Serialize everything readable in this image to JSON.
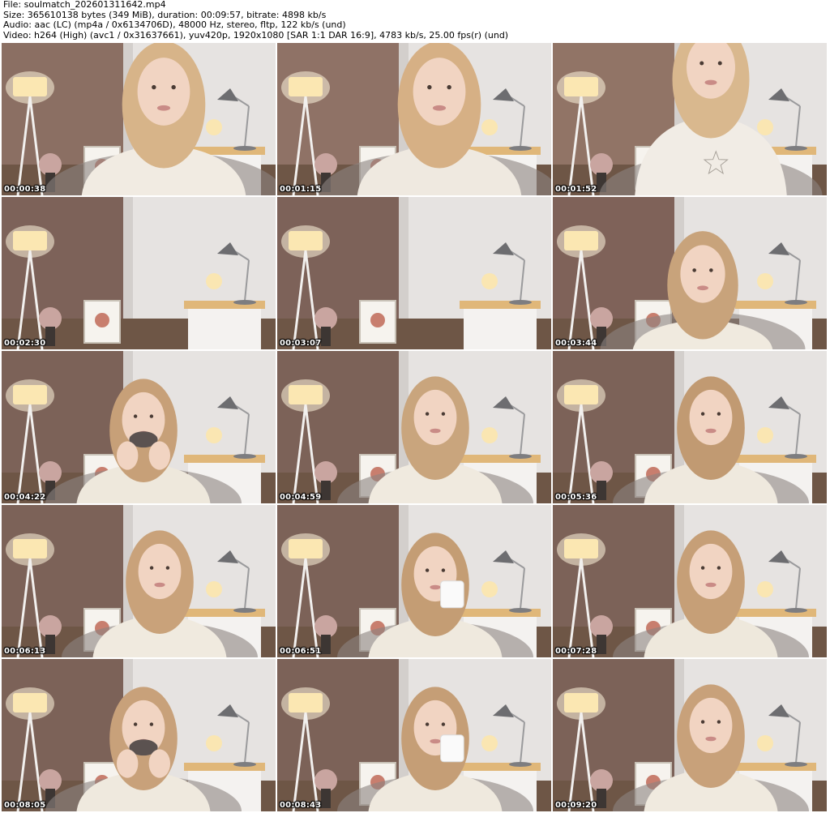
{
  "header": {
    "file_line": "File: soulmatch_202601311642.mp4",
    "size_line": "Size: 365610138 bytes (349 MiB), duration: 00:09:57, bitrate: 4898 kb/s",
    "audio_line": "Audio: aac (LC) (mp4a / 0x6134706D), 48000 Hz, stereo, fltp, 122 kb/s (und)",
    "video_line": "Video: h264 (High) (avc1 / 0x31637661), yuv420p, 1920x1080 [SAR 1:1 DAR 16:9], 4783 kb/s, 25.00 fps(r) (und)"
  },
  "thumbnails": [
    {
      "time": "00:00:38",
      "scene": "person-close",
      "wall": "#8b6f63",
      "shirt": "#f1ebe2",
      "hair": "#d7b489"
    },
    {
      "time": "00:01:15",
      "scene": "person-close",
      "wall": "#8f7266",
      "shirt": "#efe9e0",
      "hair": "#d6b085"
    },
    {
      "time": "00:01:52",
      "scene": "person-standing",
      "wall": "#917466",
      "shirt": "#f1ece5",
      "hair": "#d9b88e"
    },
    {
      "time": "00:02:30",
      "scene": "empty-room",
      "wall": "#7d6259",
      "shirt": "",
      "hair": ""
    },
    {
      "time": "00:03:07",
      "scene": "empty-room",
      "wall": "#7d6259",
      "shirt": "",
      "hair": ""
    },
    {
      "time": "00:03:44",
      "scene": "person-right",
      "wall": "#7f6259",
      "shirt": "",
      "hair": "#c8a37b"
    },
    {
      "time": "00:04:22",
      "scene": "person-eating",
      "wall": "#7c6258",
      "shirt": "#eee8dc",
      "hair": "#c7a078"
    },
    {
      "time": "00:04:59",
      "scene": "person-center",
      "wall": "#7c6258",
      "shirt": "#f0eadf",
      "hair": "#c9a57d"
    },
    {
      "time": "00:05:36",
      "scene": "person-center",
      "wall": "#7c6258",
      "shirt": "#efe9de",
      "hair": "#c19a72"
    },
    {
      "time": "00:06:13",
      "scene": "person-center",
      "wall": "#7c6258",
      "shirt": "#f0eadf",
      "hair": "#c9a27a"
    },
    {
      "time": "00:06:51",
      "scene": "person-mug",
      "wall": "#7c6258",
      "shirt": "#efe9de",
      "hair": "#c49d74"
    },
    {
      "time": "00:07:28",
      "scene": "person-center",
      "wall": "#7c6258",
      "shirt": "#eee8dc",
      "hair": "#c69f77"
    },
    {
      "time": "00:08:05",
      "scene": "person-eating",
      "wall": "#7c6258",
      "shirt": "#efe9de",
      "hair": "#c8a17a"
    },
    {
      "time": "00:08:43",
      "scene": "person-mug",
      "wall": "#7c6258",
      "shirt": "#efe9de",
      "hair": "#c59e76"
    },
    {
      "time": "00:09:20",
      "scene": "person-center",
      "wall": "#7c6258",
      "shirt": "#f0eadf",
      "hair": "#c8a17a"
    }
  ]
}
